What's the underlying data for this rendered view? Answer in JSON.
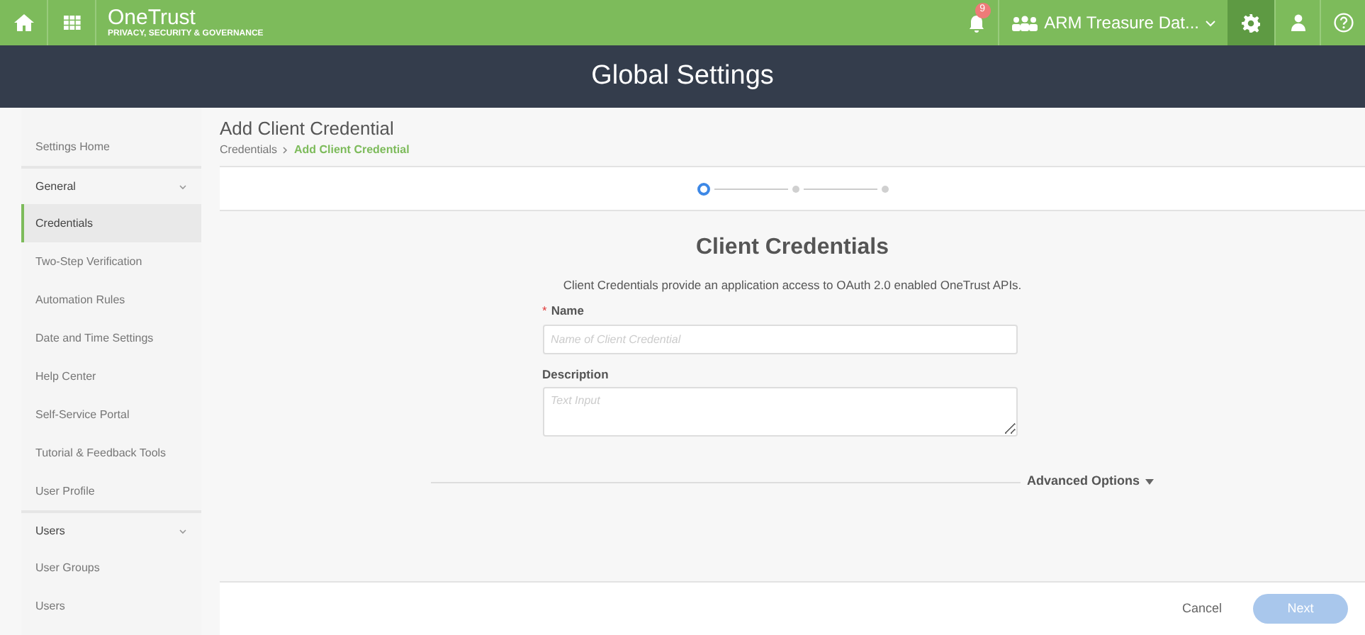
{
  "topbar": {
    "logo": "OneTrust",
    "logo_tagline": "PRIVACY, SECURITY & GOVERNANCE",
    "notifications": "9",
    "org": "ARM Treasure Dat...",
    "settings_active": true
  },
  "page_title": "Global Settings",
  "sidebar": {
    "items": [
      {
        "kind": "link",
        "label": "Settings Home",
        "selected": false
      },
      {
        "kind": "section",
        "label": "General",
        "expanded": true
      },
      {
        "kind": "link",
        "label": "Credentials",
        "selected": true
      },
      {
        "kind": "link",
        "label": "Two-Step Verification",
        "selected": false
      },
      {
        "kind": "link",
        "label": "Automation Rules",
        "selected": false
      },
      {
        "kind": "link",
        "label": "Date and Time Settings",
        "selected": false
      },
      {
        "kind": "link",
        "label": "Help Center",
        "selected": false
      },
      {
        "kind": "link",
        "label": "Self-Service Portal",
        "selected": false
      },
      {
        "kind": "link",
        "label": "Tutorial & Feedback Tools",
        "selected": false
      },
      {
        "kind": "link",
        "label": "User Profile",
        "selected": false
      },
      {
        "kind": "section",
        "label": "Users",
        "expanded": true
      },
      {
        "kind": "link",
        "label": "User Groups",
        "selected": false
      },
      {
        "kind": "link",
        "label": "Users",
        "selected": false
      }
    ]
  },
  "header": {
    "title": "Add Client Credential",
    "breadcrumb": [
      "Credentials",
      "Add Client Credential"
    ]
  },
  "stepper": [
    {
      "selected": true
    },
    {
      "selected": false
    },
    {
      "selected": false
    }
  ],
  "form": {
    "heading": "Client Credentials",
    "intro": "Client Credentials provide an application access to OAuth 2.0 enabled OneTrust APIs.",
    "fields": [
      {
        "required_mark": "*",
        "label": "Name",
        "placeholder": "Name of Client Credential",
        "kind": "input"
      },
      {
        "label": "Description",
        "placeholder": "Text Input",
        "kind": "textarea"
      }
    ],
    "advanced": "Advanced Options"
  },
  "footer": {
    "cancel": "Cancel",
    "next": "Next",
    "next_disabled": true
  }
}
